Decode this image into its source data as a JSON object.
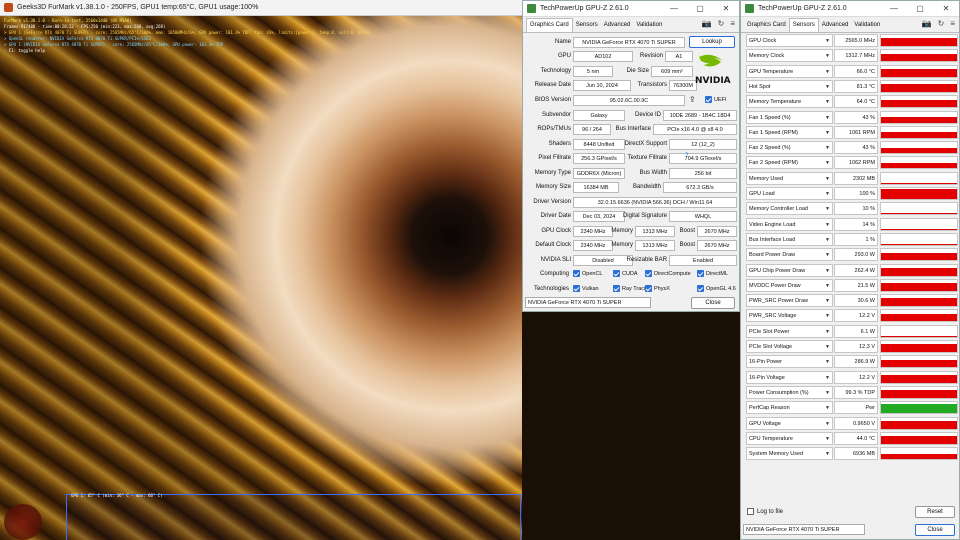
{
  "furmark": {
    "title": "Geeks3D FurMark v1.38.1.0 - 250FPS, GPU1 temp:65°C, GPU1 usage:100%",
    "osd": [
      "FurMark v1.38.1.0 - Burn-in test, 2560x1440 (0X MSAA)",
      "Frames:917488 - time:00:28:22 - FPS:250 (min:223, max:268, avg:268)",
      "> GPU 1 (GeForce RTX 4070 Ti SUPER) - core: 2565MHz/65°C/100%, mem: 10500MHz/6%, GPU power: 101.3% TDP, fan: 43%, limits:[power:1, temp:0, volt:0, OV:0]",
      "> OpenGL renderer: NVIDIA GeForce RTX 4070 Ti SUPER/PCIe/SSE2",
      "> GPU 1 (NVIDIA GeForce RTX 4070 Ti SUPER) - core: 2565MHz/65°C/100%, GPU power: 101.3% TDP",
      "- F1: toggle help"
    ],
    "graph_label": "GPU 1: 65° C (min: 36° C - max: 66° C)"
  },
  "gpuz_main": {
    "title": "TechPowerUp GPU-Z 2.61.0",
    "window_buttons": [
      "—",
      "▢",
      "✕"
    ],
    "tabs": [
      "Graphics Card",
      "Sensors",
      "Advanced",
      "Validation"
    ],
    "active_tab": "Graphics Card",
    "rows": {
      "name": {
        "label": "Name",
        "value": "NVIDIA GeForce RTX 4070 Ti SUPER"
      },
      "lookup": "Lookup",
      "gpu": {
        "label": "GPU",
        "value": "AD102"
      },
      "revision": {
        "label": "Revision",
        "value": "A1"
      },
      "technology": {
        "label": "Technology",
        "value": "5 nm"
      },
      "die_size": {
        "label": "Die Size",
        "value": "609 mm²"
      },
      "release_date": {
        "label": "Release Date",
        "value": "Jun 10, 2024"
      },
      "transistors": {
        "label": "Transistors",
        "value": "76300M"
      },
      "bios": {
        "label": "BIOS Version",
        "value": "95.02.6C.00.9C"
      },
      "uefi": "UEFI",
      "subvendor": {
        "label": "Subvendor",
        "value": "Galaxy"
      },
      "device_id": {
        "label": "Device ID",
        "value": "10DE 2689 - 1B4C 18D4"
      },
      "rops": {
        "label": "ROPs/TMUs",
        "value": "96 / 264"
      },
      "bus_interface": {
        "label": "Bus Interface",
        "value": "PCIe x16 4.0 @ x8 4.0"
      },
      "shaders": {
        "label": "Shaders",
        "value": "8448 Unified"
      },
      "directx": {
        "label": "DirectX Support",
        "value": "12 (12_2)"
      },
      "pixel_fillrate": {
        "label": "Pixel Fillrate",
        "value": "256.3 GPixel/s"
      },
      "texture_fillrate": {
        "label": "Texture Fillrate",
        "value": "704.9 GTexel/s"
      },
      "memory_type": {
        "label": "Memory Type",
        "value": "GDDR6X (Micron)"
      },
      "bus_width": {
        "label": "Bus Width",
        "value": "256 bit"
      },
      "memory_size": {
        "label": "Memory Size",
        "value": "16384 MB"
      },
      "bandwidth": {
        "label": "Bandwidth",
        "value": "672.3 GB/s"
      },
      "driver_version": {
        "label": "Driver Version",
        "value": "32.0.15.6636 (NVIDIA 566.36) DCH / Win11 64"
      },
      "driver_date": {
        "label": "Driver Date",
        "value": "Dec 03, 2024"
      },
      "digital_signature": {
        "label": "Digital Signature",
        "value": "WHQL"
      },
      "gpu_clock": {
        "label": "GPU Clock",
        "value": "2340 MHz"
      },
      "memory_clock": {
        "label": "Memory",
        "value": "1313 MHz"
      },
      "boost": {
        "label": "Boost",
        "value": "2670 MHz"
      },
      "default_clock": {
        "label": "Default Clock",
        "value": "2340 MHz"
      },
      "default_memory": {
        "label": "Memory",
        "value": "1313 MHz"
      },
      "default_boost": {
        "label": "Boost",
        "value": "2670 MHz"
      },
      "nvidia_sli": {
        "label": "NVIDIA SLI",
        "value": "Disabled"
      },
      "resizable_bar": {
        "label": "Resizable BAR",
        "value": "Enabled"
      },
      "computing": {
        "label": "Computing",
        "items": [
          "OpenCL",
          "CUDA",
          "DirectCompute",
          "DirectML"
        ]
      },
      "technologies": {
        "label": "Technologies",
        "items": [
          "Vulkan",
          "Ray Tracing",
          "PhysX",
          "OpenGL 4.6"
        ]
      }
    },
    "device_select": "NVIDIA GeForce RTX 4070 Ti SUPER",
    "close": "Close"
  },
  "gpuz_sensors": {
    "title": "TechPowerUp GPU-Z 2.61.0",
    "window_buttons": [
      "—",
      "▢",
      "✕"
    ],
    "tabs": [
      "Graphics Card",
      "Sensors",
      "Advanced",
      "Validation"
    ],
    "active_tab": "Sensors",
    "sensors": [
      {
        "name": "GPU Clock",
        "value": "2565.0 MHz",
        "level": 0.7
      },
      {
        "name": "Memory Clock",
        "value": "1312.7 MHz",
        "level": 0.7
      },
      {
        "name": "GPU Temperature",
        "value": "66.0 °C",
        "level": 0.7
      },
      {
        "name": "Hot Spot",
        "value": "81.3 °C",
        "level": 0.7
      },
      {
        "name": "Memory Temperature",
        "value": "64.0 °C",
        "level": 0.7
      },
      {
        "name": "Fan 1 Speed (%)",
        "value": "43 %",
        "level": 0.5
      },
      {
        "name": "Fan 1 Speed (RPM)",
        "value": "1061 RPM",
        "level": 0.5
      },
      {
        "name": "Fan 2 Speed (%)",
        "value": "43 %",
        "level": 0.5
      },
      {
        "name": "Fan 2 Speed (RPM)",
        "value": "1062 RPM",
        "level": 0.5
      },
      {
        "name": "Memory Used",
        "value": "2302 MB",
        "level": 0.1
      },
      {
        "name": "GPU Load",
        "value": "100 %",
        "level": 0.9
      },
      {
        "name": "Memory Controller Load",
        "value": "10 %",
        "level": 0.1
      },
      {
        "name": "Video Engine Load",
        "value": "14 %",
        "level": 0.1
      },
      {
        "name": "Bus Interface Load",
        "value": "1 %",
        "level": 0.05
      },
      {
        "name": "Board Power Draw",
        "value": "293.0 W",
        "level": 0.7
      },
      {
        "name": "GPU Chip Power Draw",
        "value": "262.4 W",
        "level": 0.7
      },
      {
        "name": "MVDDC Power Draw",
        "value": "21.5 W",
        "level": 0.7
      },
      {
        "name": "PWR_SRC Power Draw",
        "value": "30.6 W",
        "level": 0.7
      },
      {
        "name": "PWR_SRC Voltage",
        "value": "12.2 V",
        "level": 0.7
      },
      {
        "name": "PCIe Slot Power",
        "value": "6.1 W",
        "level": 0.1
      },
      {
        "name": "PCIe Slot Voltage",
        "value": "12.3 V",
        "level": 0.7
      },
      {
        "name": "16-Pin Power",
        "value": "286.9 W",
        "level": 0.7
      },
      {
        "name": "16-Pin Voltage",
        "value": "12.2 V",
        "level": 0.7
      },
      {
        "name": "Power Consumption (%)",
        "value": "99.3 % TDP",
        "level": 0.7
      },
      {
        "name": "PerfCap Reason",
        "value": "Pwr",
        "level": 0.8,
        "color": "#22aa22"
      },
      {
        "name": "GPU Voltage",
        "value": "0.9650 V",
        "level": 0.7
      },
      {
        "name": "CPU Temperature",
        "value": "44.0 °C",
        "level": 0.7
      },
      {
        "name": "System Memory Used",
        "value": "6936 MB",
        "level": 0.5
      }
    ],
    "log_to_file": "Log to file",
    "reset": "Reset",
    "device_select": "NVIDIA GeForce RTX 4070 Ti SUPER",
    "close": "Close"
  },
  "colors": {
    "bar": "#e30000",
    "perfcap": "#22aa22",
    "checkbox": "#2a6fd6"
  }
}
